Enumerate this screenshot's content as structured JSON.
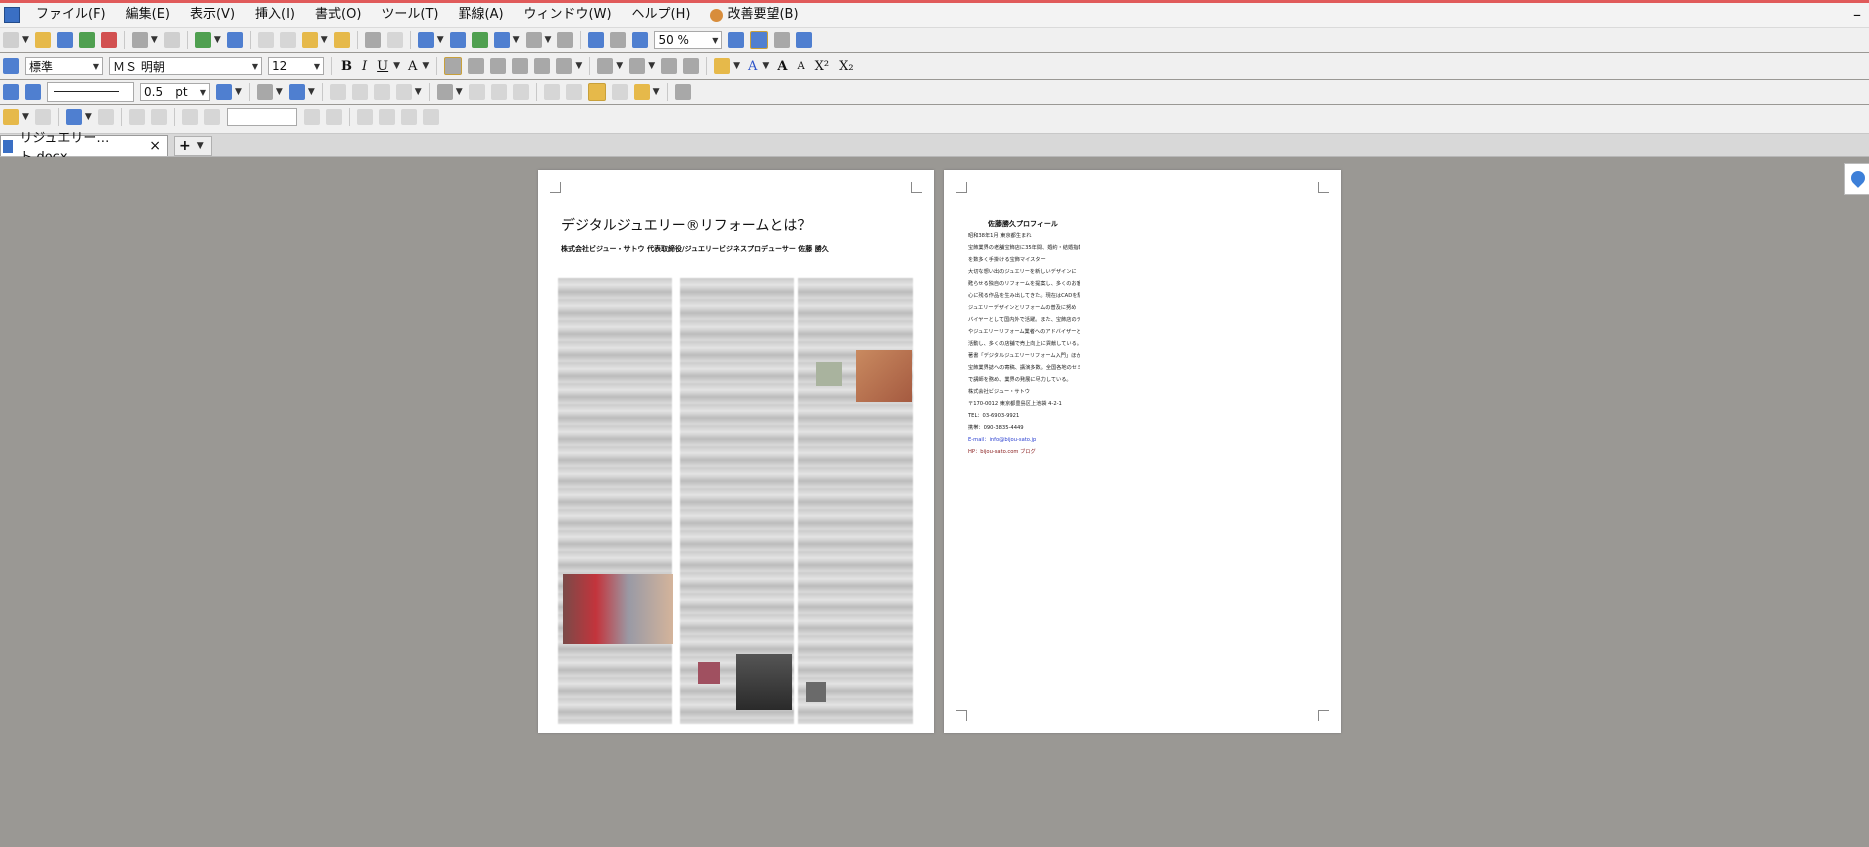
{
  "menu": {
    "items": [
      "ファイル(F)",
      "編集(E)",
      "表示(V)",
      "挿入(I)",
      "書式(O)",
      "ツール(T)",
      "罫線(A)",
      "ウィンドウ(W)",
      "ヘルプ(H)"
    ],
    "kaizen": "改善要望(B)",
    "minimize": "–"
  },
  "toolbar": {
    "zoom": "50 %",
    "style": "標準",
    "font": "ＭＳ 明朝",
    "size": "12",
    "bold": "B",
    "italic": "I",
    "underline": "U",
    "fontsize_up": "A",
    "fontsize_down": "A",
    "superscript": "X²",
    "subscript": "X₂",
    "char_A": "A",
    "line_width": "0.5",
    "line_unit": "pt"
  },
  "tabs": {
    "active": "リジュエリー…ト.docx",
    "close": "×",
    "new": "+"
  },
  "page1": {
    "title": "デジタルジュエリー®リフォームとは？",
    "subtitle": "株式会社ビジュー・サトウ 代表取締役/ジュエリービジネスプロデューサー 佐藤 勝久"
  },
  "page2": {
    "title": "佐藤勝久プロフィール",
    "lines": [
      "昭和38年1月 東京都生まれ",
      "宝飾業界の老舗宝飾店に35年間、婚約・結婚指輪",
      "を数多く手掛ける宝飾マイスター",
      "大切な想い出のジュエリーを新しいデザインに",
      "甦らせる独自のリフォームを提案し、多くのお客様の",
      "心に残る作品を生み出してきた。現在はCADを駆使した",
      "ジュエリーデザインとリフォームの普及に努め",
      "バイヤーとして国内外で活躍。また、宝飾店のデザイナー",
      "やジュエリーリフォーム業者へのアドバイザーとしても",
      "活動し、多くの店舗で売上向上に貢献している。",
      "著書「デジタルジュエリーリフォーム入門」ほか",
      "宝飾業界誌への寄稿、講演多数。全国各地のセミナー",
      "で講師を務め、業界の発展に尽力している。",
      "株式会社ビジュー・サトウ",
      "〒170-0012 東京都豊島区上池袋 4-2-1",
      "TEL：03-6903-9921",
      "携帯：090-3835-4449",
      "E-mail：info@bijou-sato.jp",
      "HP：bijou-sato.com ブログ"
    ]
  },
  "colors": {
    "accent": "#e05a5a",
    "workspace": "#9a9894",
    "link": "#2a3fd0"
  }
}
